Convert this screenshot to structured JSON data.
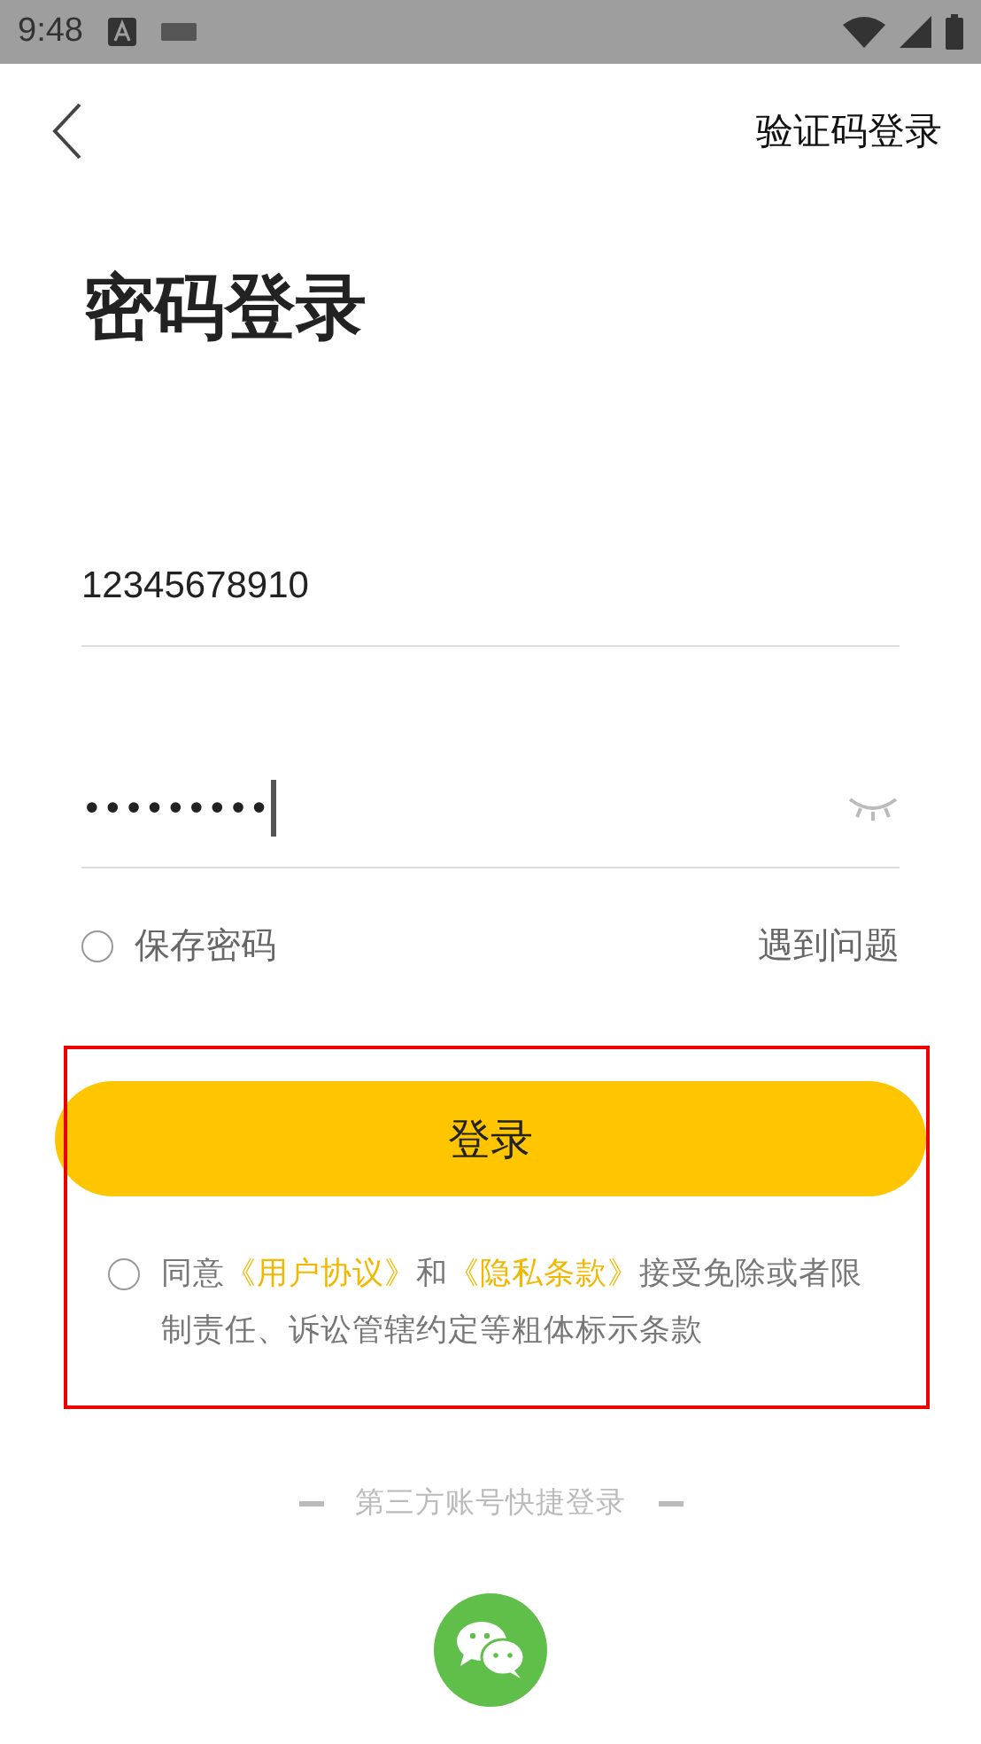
{
  "status_bar": {
    "time": "9:48"
  },
  "header": {
    "switch_link": "验证码登录"
  },
  "title": "密码登录",
  "phone_field": {
    "value": "12345678910"
  },
  "password_field": {
    "value": "•••••••••",
    "visible": false
  },
  "save_password": {
    "label": "保存密码",
    "checked": false
  },
  "help_link": "遇到问题",
  "login_button": "登录",
  "agreement": {
    "checked": false,
    "parts": [
      {
        "kind": "text",
        "text": "同意"
      },
      {
        "kind": "link",
        "text": "《用户协议》"
      },
      {
        "kind": "text",
        "text": "和"
      },
      {
        "kind": "link",
        "text": "《隐私条款》"
      },
      {
        "kind": "text",
        "text": "接受免除或者限制责任、诉讼管辖约定等粗体标示条款"
      }
    ]
  },
  "highlight": true,
  "third_party": {
    "label": "第三方账号快捷登录"
  }
}
